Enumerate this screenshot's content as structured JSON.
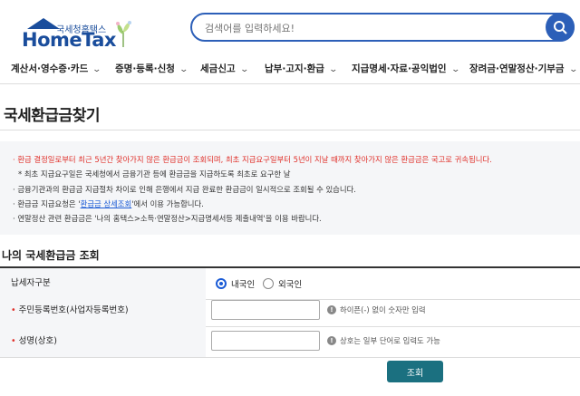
{
  "header": {
    "logo_sub": "국세청홈택스",
    "logo_main": "HomeTax",
    "search_placeholder": "검색어를 입력하세요!"
  },
  "nav": {
    "items": [
      {
        "label": "계산서·영수증·카드"
      },
      {
        "label": "증명·등록·신청"
      },
      {
        "label": "세금신고"
      },
      {
        "label": "납부·고지·환급"
      },
      {
        "label": "지급명세·자료·공익법인"
      },
      {
        "label": "장려금·연말정산·기부금"
      }
    ]
  },
  "page": {
    "title": "국세환급금찾기"
  },
  "notice": {
    "line1": "환급 결정일로부터 최근 5년간 찾아가지 않은 환급금이 조회되며, 최초 지급요구일부터 5년이 지날 때까지 찾아가지 않은 환급금은 국고로 귀속됩니다.",
    "line2": "* 최초 지급요구일은 국세청에서 금융기관 등에 환급금을 지급하도록 최초로 요구한 날",
    "line3": "금융기관과의 환급금 지급절차 차이로 인해 은행에서 지급 완료한 환급금이 일시적으로 조회될 수 있습니다.",
    "line4_prefix": "환급금 지급요청은 '",
    "line4_link": "환급금 상세조회",
    "line4_suffix": "'에서 이용 가능합니다.",
    "line5": "연말정산 관련 환급금은 '나의 홈택스>소득·연말정산>지급명세서등 제출내역'을 이용 바랍니다."
  },
  "form": {
    "section_title": "나의 국세환급금 조회",
    "taxpayer_type_label": "납세자구분",
    "taxpayer_options": [
      {
        "label": "내국인",
        "selected": true
      },
      {
        "label": "외국인",
        "selected": false
      }
    ],
    "reg_number_label": "주민등록번호(사업자등록번호)",
    "reg_number_hint": "하이픈(-) 없이 숫자만 입력",
    "name_label": "성명(상호)",
    "name_hint": "상호는 일부 단어로 입력도 가능",
    "submit_label": "조회"
  },
  "colors": {
    "brand_blue": "#1a4d9c",
    "search_blue": "#2c5fb8",
    "alert_red": "#e0312b",
    "button_teal": "#1b7080"
  }
}
